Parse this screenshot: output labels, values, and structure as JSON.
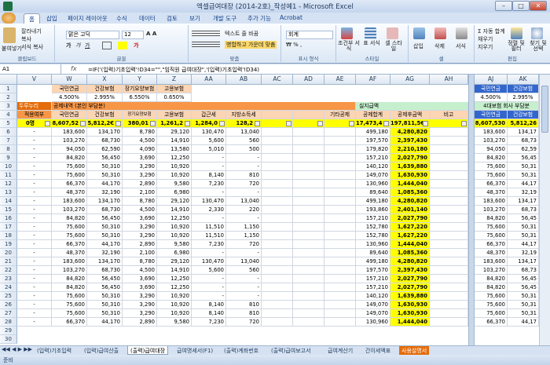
{
  "window": {
    "title": "엑셀급여대장 (2014-2호)_작성예1 - Microsoft Excel"
  },
  "tabs": [
    "홈",
    "삽입",
    "페이지 레이아웃",
    "수식",
    "데이터",
    "검토",
    "보기",
    "개발 도구",
    "추가 기능",
    "Acrobat"
  ],
  "ribbon": {
    "paste": "붙여넣기",
    "cut": "잘라내기",
    "copy": "복사",
    "format_painter": "서식 복사",
    "clipboard": "클립보드",
    "font_name": "맑은 고딕",
    "font_size": "12",
    "font_group": "글꼴",
    "wrap": "텍스트 줄 바꿈",
    "merge": "병합하고 가운데 맞춤",
    "align_group": "맞춤",
    "number_format": "회계",
    "number_group": "표시 형식",
    "cond_format": "조건부 서식",
    "table_format": "표 서식",
    "cell_style": "셀 스타일",
    "styles_group": "스타일",
    "insert": "삽입",
    "delete": "삭제",
    "format": "서식",
    "cells_group": "셀",
    "autosum": "자동 합계",
    "fill": "채우기",
    "clear": "지우기",
    "sort": "정렬 및 필터",
    "find": "찾기 및 선택",
    "edit_group": "편집"
  },
  "formula_bar": {
    "name_box": "A1",
    "formula": "=IF('(입력)기초입력'!D34=\"\",\"임직원 급여대장\",'(입력)기초입력'!D34)"
  },
  "columns": [
    "V",
    "W",
    "X",
    "Y",
    "Z",
    "AA",
    "AB",
    "AC",
    "AD",
    "AE",
    "AF",
    "AG",
    "AH",
    "AI",
    "AJ",
    "AK"
  ],
  "header_rows": {
    "row1": [
      "국민연금",
      "건강보험",
      "장기요양보험",
      "고용보험"
    ],
    "row2": [
      "4.500%",
      "2.995%",
      "6.550%",
      "0.650%"
    ],
    "row3_left": "두루누리",
    "row3_mid": "공제내역 (본인 부담분)",
    "row3_right": "실지급액",
    "row3_far": "4대보험 회사 부담분",
    "row4": [
      "적용여부",
      "국민연금",
      "건강보험",
      "장기요양보험",
      "고용보험",
      "갑근세",
      "지방소득세",
      "",
      "",
      "기타공제",
      "공제합계",
      "공제후금액",
      "비고"
    ],
    "row5": [
      "0명",
      "8,607,52",
      "5,812,2€",
      "380,01",
      "1,261,2",
      "1,284,0",
      "128,2",
      "",
      "",
      "",
      "17,473,4",
      "197,811,5€",
      ""
    ],
    "right_row1": [
      "국민연금",
      "건강보험"
    ],
    "right_row2": [
      "4.500%",
      "2.995%"
    ],
    "right_row4": [
      "국민연금",
      "건강보험"
    ],
    "right_row5": [
      "8,607,530",
      "5,812,26"
    ]
  },
  "row_numbers": [
    "1",
    "2",
    "3",
    "4",
    "5",
    "6",
    "7",
    "8",
    "9",
    "10",
    "11",
    "12",
    "13",
    "14",
    "15",
    "16",
    "17",
    "18",
    "19",
    "20",
    "21",
    "22",
    "23",
    "24",
    "25",
    "26",
    "27",
    "28",
    "29",
    "30"
  ],
  "data_rows": [
    [
      "-",
      "183,600",
      "134,170",
      "8,780",
      "29,120",
      "130,470",
      "13,040",
      "",
      "",
      "",
      "499,180",
      "4,280,820",
      "",
      "183,600",
      "134,17"
    ],
    [
      "-",
      "103,270",
      "68,730",
      "4,500",
      "14,910",
      "5,600",
      "560",
      "",
      "",
      "",
      "197,570",
      "2,397,430",
      "",
      "103,270",
      "68,73"
    ],
    [
      "-",
      "94,050",
      "62,590",
      "4,090",
      "13,580",
      "5,010",
      "500",
      "",
      "",
      "",
      "179,820",
      "2,210,180",
      "",
      "94,050",
      "62,59"
    ],
    [
      "-",
      "84,820",
      "56,450",
      "3,690",
      "12,250",
      "-",
      "-",
      "",
      "",
      "",
      "157,210",
      "2,027,790",
      "",
      "84,820",
      "56,45"
    ],
    [
      "-",
      "75,600",
      "50,310",
      "3,290",
      "10,920",
      "-",
      "-",
      "",
      "",
      "",
      "140,120",
      "1,639,880",
      "",
      "75,600",
      "50,31"
    ],
    [
      "-",
      "75,600",
      "50,310",
      "3,290",
      "10,920",
      "8,140",
      "810",
      "",
      "",
      "",
      "149,070",
      "1,630,930",
      "",
      "75,600",
      "50,31"
    ],
    [
      "-",
      "66,370",
      "44,170",
      "2,890",
      "9,580",
      "7,230",
      "720",
      "",
      "",
      "",
      "130,960",
      "1,444,040",
      "",
      "66,370",
      "44,17"
    ],
    [
      "-",
      "48,370",
      "32,190",
      "2,100",
      "6,980",
      "-",
      "-",
      "",
      "",
      "",
      "89,640",
      "1,085,360",
      "",
      "48,370",
      "32,19"
    ],
    [
      "-",
      "183,600",
      "134,170",
      "8,780",
      "29,120",
      "130,470",
      "13,040",
      "",
      "",
      "",
      "499,180",
      "4,280,820",
      "",
      "183,600",
      "134,17"
    ],
    [
      "-",
      "103,270",
      "68,730",
      "4,500",
      "14,910",
      "2,330",
      "220",
      "",
      "",
      "",
      "193,860",
      "2,401,140",
      "",
      "103,270",
      "68,73"
    ],
    [
      "-",
      "84,820",
      "56,450",
      "3,690",
      "12,250",
      "-",
      "-",
      "",
      "",
      "",
      "157,210",
      "2,027,790",
      "",
      "84,820",
      "56,45"
    ],
    [
      "-",
      "75,600",
      "50,310",
      "3,290",
      "10,920",
      "11,510",
      "1,150",
      "",
      "",
      "",
      "152,780",
      "1,627,220",
      "",
      "75,600",
      "50,31"
    ],
    [
      "-",
      "75,600",
      "50,310",
      "3,290",
      "10,920",
      "11,510",
      "1,150",
      "",
      "",
      "",
      "152,780",
      "1,627,220",
      "",
      "75,600",
      "50,31"
    ],
    [
      "-",
      "66,370",
      "44,170",
      "2,890",
      "9,580",
      "7,230",
      "720",
      "",
      "",
      "",
      "130,960",
      "1,444,040",
      "",
      "66,370",
      "44,17"
    ],
    [
      "-",
      "48,370",
      "32,190",
      "2,100",
      "6,980",
      "-",
      "-",
      "",
      "",
      "",
      "89,640",
      "1,085,360",
      "",
      "48,370",
      "32,19"
    ],
    [
      "-",
      "183,600",
      "134,170",
      "8,780",
      "29,120",
      "130,470",
      "13,040",
      "",
      "",
      "",
      "499,180",
      "4,280,820",
      "",
      "183,600",
      "134,17"
    ],
    [
      "-",
      "103,270",
      "68,730",
      "4,500",
      "14,910",
      "5,600",
      "560",
      "",
      "",
      "",
      "197,570",
      "2,397,430",
      "",
      "103,270",
      "68,73"
    ],
    [
      "-",
      "84,820",
      "56,450",
      "3,690",
      "12,250",
      "-",
      "-",
      "",
      "",
      "",
      "157,210",
      "2,027,790",
      "",
      "84,820",
      "56,45"
    ],
    [
      "-",
      "84,820",
      "56,450",
      "3,690",
      "12,250",
      "-",
      "-",
      "",
      "",
      "",
      "157,210",
      "2,027,790",
      "",
      "84,820",
      "56,45"
    ],
    [
      "-",
      "75,600",
      "50,310",
      "3,290",
      "10,920",
      "-",
      "-",
      "",
      "",
      "",
      "140,120",
      "1,639,880",
      "",
      "75,600",
      "50,31"
    ],
    [
      "-",
      "75,600",
      "50,310",
      "3,290",
      "10,920",
      "8,140",
      "810",
      "",
      "",
      "",
      "149,070",
      "1,630,930",
      "",
      "75,600",
      "50,31"
    ],
    [
      "-",
      "75,600",
      "50,310",
      "3,290",
      "10,920",
      "8,140",
      "810",
      "",
      "",
      "",
      "149,070",
      "1,630,930",
      "",
      "75,600",
      "50,31"
    ],
    [
      "-",
      "66,370",
      "44,170",
      "2,890",
      "9,580",
      "7,230",
      "720",
      "",
      "",
      "",
      "130,960",
      "1,444,040",
      "",
      "66,370",
      "44,17"
    ]
  ],
  "sheet_tabs": [
    "(입력)기초입력",
    "(입력)급여산출",
    "(출력)급여대장",
    "급여명세서(F1)",
    "(출력)계좌번호",
    "(출력)급여보고서",
    "급여계산기",
    "간이세액표",
    "사용설명서"
  ],
  "status": {
    "ready": "준비"
  },
  "colors": {
    "orange": "#f79646",
    "peach": "#fcd5b4",
    "yellow": "#ffff00",
    "blue": "#3366cc",
    "green": "#c6efce"
  }
}
